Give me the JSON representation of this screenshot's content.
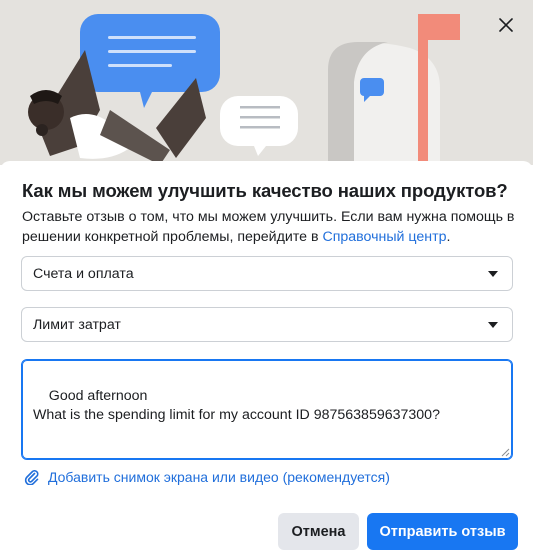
{
  "dialog": {
    "title": "Как мы можем улучшить качество наших продуктов?",
    "description_prefix": "Оставьте отзыв о том, что мы можем улучшить. Если вам нужна помощь в решении конкретной проблемы, перейдите в ",
    "help_center_link": "Справочный центр",
    "description_suffix": "."
  },
  "form": {
    "category_select": {
      "value": "Счета и оплата"
    },
    "subcategory_select": {
      "value": "Лимит затрат"
    },
    "feedback_text": "Good afternoon\nWhat is the spending limit for my account ID 987563859637300?",
    "attach_label": "Добавить снимок экрана или видео (рекомендуется)"
  },
  "actions": {
    "cancel_label": "Отмена",
    "submit_label": "Отправить отзыв"
  },
  "colors": {
    "accent": "#1877f2",
    "link": "#216fdb",
    "hero_bg": "#e4e2de",
    "bubble_blue": "#4a8ef0",
    "mailbox_flag": "#f28b7a"
  },
  "icons": {
    "close": "close-icon",
    "select_caret": "caret-down-icon",
    "attach": "paperclip-icon"
  }
}
